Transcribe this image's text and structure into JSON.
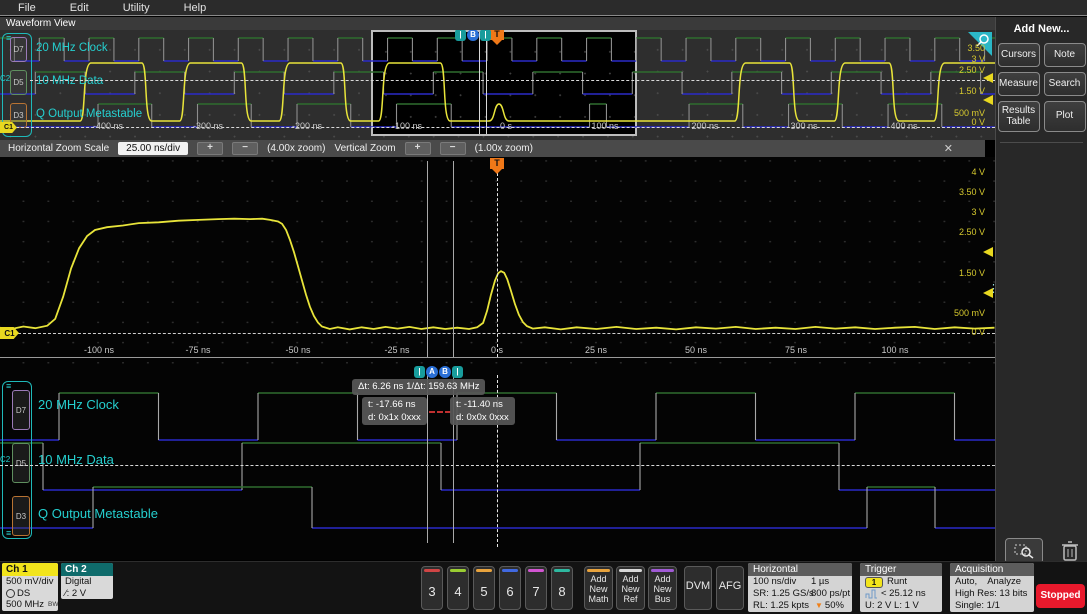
{
  "menu": {
    "items": [
      "File",
      "Edit",
      "Utility",
      "Help"
    ]
  },
  "view_title": "Waveform View",
  "overview": {
    "channels": [
      {
        "badge": "D7",
        "label": "20 MHz Clock"
      },
      {
        "badge": "D5",
        "label": "10 MHz Data"
      },
      {
        "badge": "D3",
        "label": "Q Output Metastable"
      }
    ],
    "group_label": "C2",
    "ground_badge": "C1",
    "xticks": [
      "-400 ns",
      "-300 ns",
      "-200 ns",
      "-100 ns",
      "0 s",
      "100 ns",
      "200 ns",
      "300 ns",
      "400 ns"
    ],
    "yticks": [
      "3.50",
      "3 V",
      "2.50 V",
      "1.50 V",
      "500 mV",
      "0 V"
    ],
    "cursor_badges": [
      "|",
      "B",
      "|"
    ],
    "trigger_label": "T"
  },
  "zoom_toolbar": {
    "h_label": "Horizontal Zoom Scale",
    "h_value": "25.00 ns/div",
    "plus": "+",
    "minus": "−",
    "h_zoom": "(4.00x zoom)",
    "v_label": "Vertical Zoom",
    "v_zoom": "(1.00x zoom)",
    "close": "✕"
  },
  "zoom_view": {
    "xticks": [
      "-100 ns",
      "-75 ns",
      "-50 ns",
      "-25 ns",
      "0 s",
      "25 ns",
      "50 ns",
      "75 ns",
      "100 ns"
    ],
    "yticks": [
      "4 V",
      "3.50 V",
      "3 V",
      "2.50 V",
      "1.50 V",
      "500 mV",
      "0 V"
    ],
    "trigger_label": "T",
    "ground_badge": "C1"
  },
  "digital_view": {
    "channels": [
      {
        "badge": "D7",
        "label": "20 MHz Clock"
      },
      {
        "badge": "D5",
        "label": "10 MHz Data"
      },
      {
        "badge": "D3",
        "label": "Q Output Metastable"
      }
    ],
    "group_label": "C2",
    "cursor_badges": [
      "|",
      "A",
      "B",
      "|"
    ],
    "readouts": {
      "dt": "Δt:  6.26 ns 1/Δt:  159.63 MHz",
      "a_t": "t: -17.66 ns",
      "a_d": "d: 0x1x 0xxx",
      "b_t": "t: -11.40 ns",
      "b_d": "d: 0x0x 0xxx"
    }
  },
  "sidebar": {
    "title": "Add New...",
    "buttons": [
      "Cursors",
      "Note",
      "Measure",
      "Search",
      "Results Table",
      "Plot"
    ]
  },
  "bottom": {
    "ch1": {
      "name": "Ch 1",
      "r1": "500 mV/div",
      "r2": "DS",
      "r3": "500 MHz"
    },
    "ch2": {
      "name": "Ch 2",
      "r1": "Digital",
      "r2": "∕: 2 V"
    },
    "channels": [
      "3",
      "4",
      "5",
      "6",
      "7",
      "8"
    ],
    "adds": [
      "Add New Math",
      "Add New Ref",
      "Add New Bus"
    ],
    "dvm": "DVM",
    "afg": "AFG",
    "horizontal": {
      "title": "Horizontal",
      "scale": "100 ns/div",
      "duration": "1 µs",
      "sr": "SR: 1.25 GS/s",
      "res": "800 ps/pt",
      "rl": "RL: 1.25 kpts",
      "pos": "50%"
    },
    "trigger": {
      "title": "Trigger",
      "source": "1",
      "type": "Runt",
      "cond": "< 25.12 ns",
      "levels": "U: 2 V  L: 1 V"
    },
    "acq": {
      "title": "Acquisition",
      "r1a": "Auto,",
      "r1b": "Analyze",
      "r2": "High Res: 13 bits",
      "r3": "Single: 1/1"
    },
    "stopped": "Stopped"
  },
  "colors": {
    "ch1_yellow": "#e8e43a",
    "accent_cyan": "#25cfcf",
    "trigger_orange": "#f07818",
    "stopped_red": "#e8192c",
    "digital_high_green": "#2f6d2f",
    "digital_low_blue": "#2a2ac8"
  }
}
